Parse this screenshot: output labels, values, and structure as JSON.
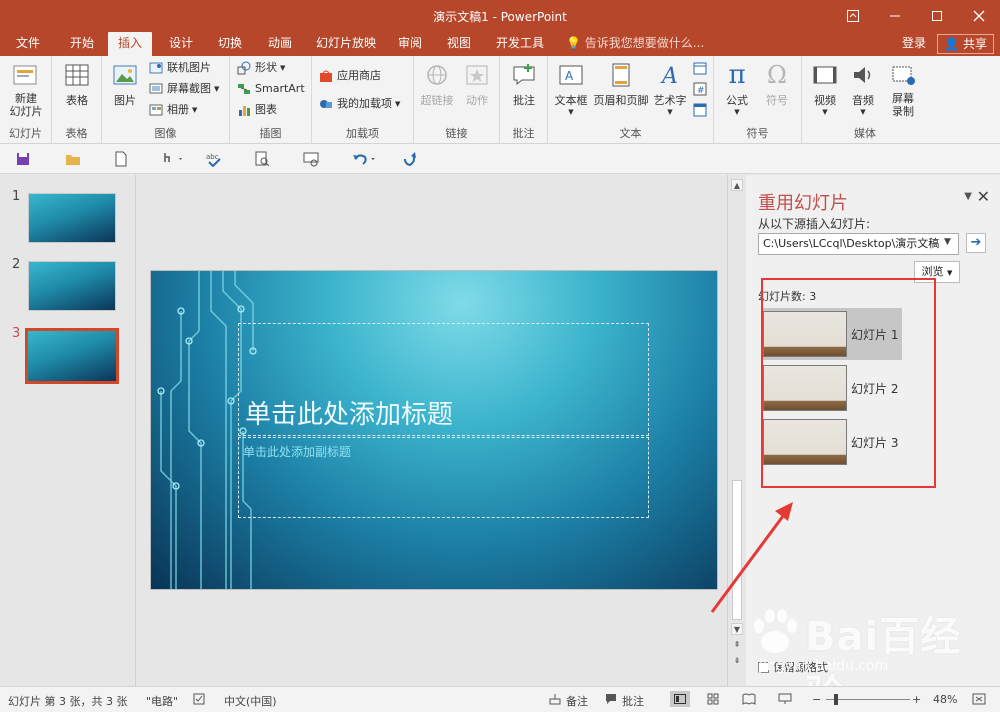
{
  "window": {
    "title": "演示文稿1 - PowerPoint",
    "buttons": [
      "ribbon-display",
      "minimize",
      "maximize",
      "close"
    ]
  },
  "tabs": [
    "文件",
    "开始",
    "插入",
    "设计",
    "切换",
    "动画",
    "幻灯片放映",
    "审阅",
    "视图",
    "开发工具"
  ],
  "active_tab": "插入",
  "tellme": "告诉我您想要做什么...",
  "account": {
    "login": "登录",
    "share": "共享"
  },
  "ribbon": {
    "slides": {
      "label": "幻灯片",
      "new_slide": "新建\n幻灯片"
    },
    "tables": {
      "label": "表格",
      "table": "表格"
    },
    "images": {
      "label": "图像",
      "picture": "图片",
      "online_pictures": "联机图片",
      "screenshot": "屏幕截图",
      "album": "相册"
    },
    "illustrations": {
      "label": "插图",
      "shapes": "形状",
      "smartart": "SmartArt",
      "chart": "图表"
    },
    "addins": {
      "label": "加载项",
      "store": "应用商店",
      "my_addins": "我的加载项"
    },
    "links": {
      "label": "链接",
      "hyperlink": "超链接",
      "action": "动作"
    },
    "comments": {
      "label": "批注",
      "comment": "批注"
    },
    "text": {
      "label": "文本",
      "textbox": "文本框",
      "header_footer": "页眉和页脚",
      "wordart": "艺术字"
    },
    "symbols": {
      "label": "符号",
      "equation": "公式",
      "symbol": "符号"
    },
    "media": {
      "label": "媒体",
      "video": "视频",
      "audio": "音频",
      "screen_recording": "屏幕\n录制"
    }
  },
  "slides": [
    {
      "number": "1"
    },
    {
      "number": "2"
    },
    {
      "number": "3"
    }
  ],
  "active_slide": "3",
  "slide": {
    "title_placeholder": "单击此处添加标题",
    "subtitle_placeholder": "单击此处添加副标题"
  },
  "reuse_pane": {
    "title": "重用幻灯片",
    "insert_from_label": "从以下源插入幻灯片:",
    "path": "C:\\Users\\LCcql\\Desktop\\演示文稿",
    "browse": "浏览",
    "count_label": "幻灯片数: 3",
    "items": [
      "幻灯片 1",
      "幻灯片 2",
      "幻灯片 3"
    ],
    "keep_format": "保留源格式"
  },
  "status": {
    "slide_info": "幻灯片 第 3 张，共 3 张",
    "theme": "\"电路\"",
    "language": "中文(中国)",
    "notes": "备注",
    "comments": "批注",
    "zoom": "48%"
  },
  "watermark": {
    "brand": "Bai百经验",
    "url": "jingyan.baidu.com"
  },
  "colors": {
    "accent": "#b7472a",
    "selection_border": "#d24726",
    "annotation": "#e53935"
  }
}
